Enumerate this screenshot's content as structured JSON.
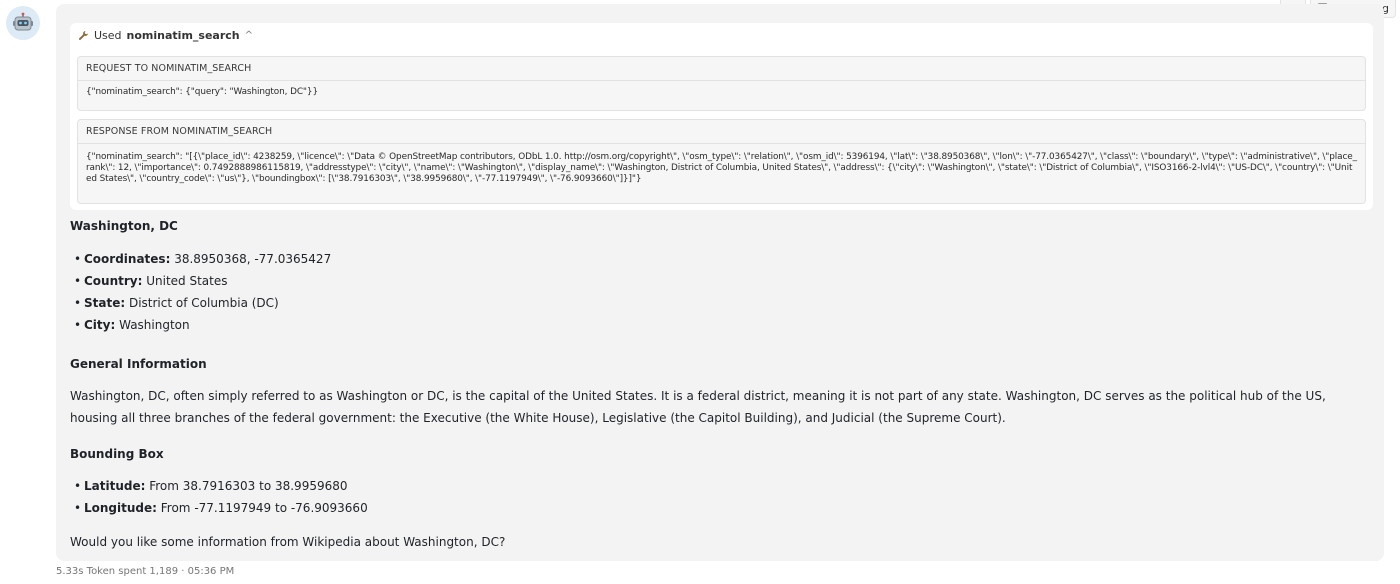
{
  "top_actions": {
    "agent_log_label": "Agent Log"
  },
  "tool_call": {
    "used_prefix": "Used",
    "tool_name": "nominatim_search",
    "request_title": "REQUEST TO NOMINATIM_SEARCH",
    "request_body": "{\"nominatim_search\": {\"query\": \"Washington, DC\"}}",
    "response_title": "RESPONSE FROM NOMINATIM_SEARCH",
    "response_body": "{\"nominatim_search\": \"[{\\\"place_id\\\": 4238259, \\\"licence\\\": \\\"Data © OpenStreetMap contributors, ODbL 1.0. http://osm.org/copyright\\\", \\\"osm_type\\\": \\\"relation\\\", \\\"osm_id\\\": 5396194, \\\"lat\\\": \\\"38.8950368\\\", \\\"lon\\\": \\\"-77.0365427\\\", \\\"class\\\": \\\"boundary\\\", \\\"type\\\": \\\"administrative\\\", \\\"place_rank\\\": 12, \\\"importance\\\": 0.7492888986115819, \\\"addresstype\\\": \\\"city\\\", \\\"name\\\": \\\"Washington\\\", \\\"display_name\\\": \\\"Washington, District of Columbia, United States\\\", \\\"address\\\": {\\\"city\\\": \\\"Washington\\\", \\\"state\\\": \\\"District of Columbia\\\", \\\"ISO3166-2-lvl4\\\": \\\"US-DC\\\", \\\"country\\\": \\\"United States\\\", \\\"country_code\\\": \\\"us\\\"}, \\\"boundingbox\\\": [\\\"38.7916303\\\", \\\"38.9959680\\\", \\\"-77.1197949\\\", \\\"-76.9093660\\\"]}]\"}"
  },
  "answer": {
    "heading1": "Washington, DC",
    "list1": [
      {
        "label": "Coordinates:",
        "value": " 38.8950368, -77.0365427"
      },
      {
        "label": "Country:",
        "value": " United States"
      },
      {
        "label": "State:",
        "value": " District of Columbia (DC)"
      },
      {
        "label": "City:",
        "value": " Washington"
      }
    ],
    "heading2": "General Information",
    "paragraph": "Washington, DC, often simply referred to as Washington or DC, is the capital of the United States. It is a federal district, meaning it is not part of any state. Washington, DC serves as the political hub of the US, housing all three branches of the federal government: the Executive (the White House), Legislative (the Capitol Building), and Judicial (the Supreme Court).",
    "heading3": "Bounding Box",
    "list2": [
      {
        "label": "Latitude:",
        "value": " From 38.7916303 to 38.9959680"
      },
      {
        "label": "Longitude:",
        "value": " From -77.1197949 to -76.9093660"
      }
    ],
    "closing": "Would you like some information from Wikipedia about Washington, DC?"
  },
  "footer": {
    "meta": "5.33s  Token spent 1,189  ·  05:36 PM"
  }
}
